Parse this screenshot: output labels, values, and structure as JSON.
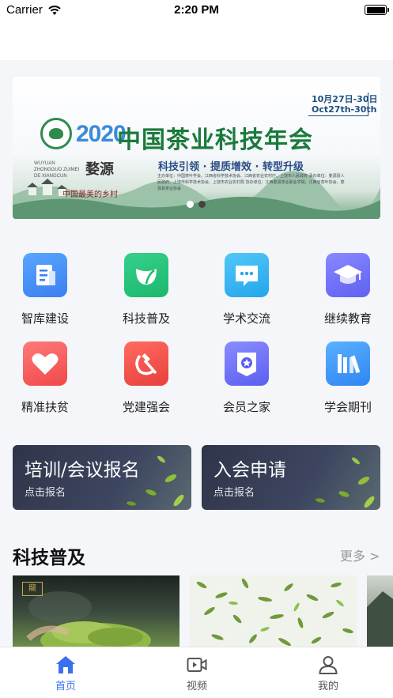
{
  "status_bar": {
    "carrier": "Carrier",
    "time": "2:20 PM"
  },
  "banner": {
    "year": "2020",
    "title": "中国茶业科技年会",
    "date_cn": "10月27日-30日",
    "date_en": "Oct27th-30th",
    "slogan": "科技引领 · 提质增效 · 转型升级",
    "calligraphy": "婺源",
    "village": "中国最美的乡村",
    "pinyin": "WUYUAN ZHONGGUO ZUIMEI DE XIANGCUN",
    "organizers": "主办单位：中国茶叶学会、江西省科学技术协会、江西省农业农村厅、上饶市人民政府 承办单位：婺源县人民政府、上饶市科学技术协会、上饶市农业农村局 协办单位：江西婺源茶业职业学院、江西省茶叶协会、婺源县茶业协会",
    "page_dots": 2,
    "active_dot": 2
  },
  "grid": [
    {
      "label": "智库建设",
      "icon": "document-icon"
    },
    {
      "label": "科技普及",
      "icon": "leaf-icon"
    },
    {
      "label": "学术交流",
      "icon": "chat-icon"
    },
    {
      "label": "继续教育",
      "icon": "graduation-cap-icon"
    },
    {
      "label": "精准扶贫",
      "icon": "heart-icon"
    },
    {
      "label": "党建强会",
      "icon": "hammer-sickle-icon"
    },
    {
      "label": "会员之家",
      "icon": "member-badge-icon"
    },
    {
      "label": "学会期刊",
      "icon": "books-icon"
    }
  ],
  "cta": {
    "left": {
      "title": "培训/会议报名",
      "subtitle": "点击报名"
    },
    "right": {
      "title": "入会申请",
      "subtitle": "点击报名"
    }
  },
  "section": {
    "title": "科技普及",
    "more": "更多 >"
  },
  "thumb_logo": "龍",
  "tabbar": [
    {
      "label": "首页",
      "icon": "home-icon",
      "active": true
    },
    {
      "label": "视频",
      "icon": "video-icon",
      "active": false
    },
    {
      "label": "我的",
      "icon": "user-icon",
      "active": false
    }
  ],
  "colors": {
    "accent": "#3a6ff0",
    "tab_inactive": "#555555",
    "banner_title": "#1a7a3c"
  }
}
